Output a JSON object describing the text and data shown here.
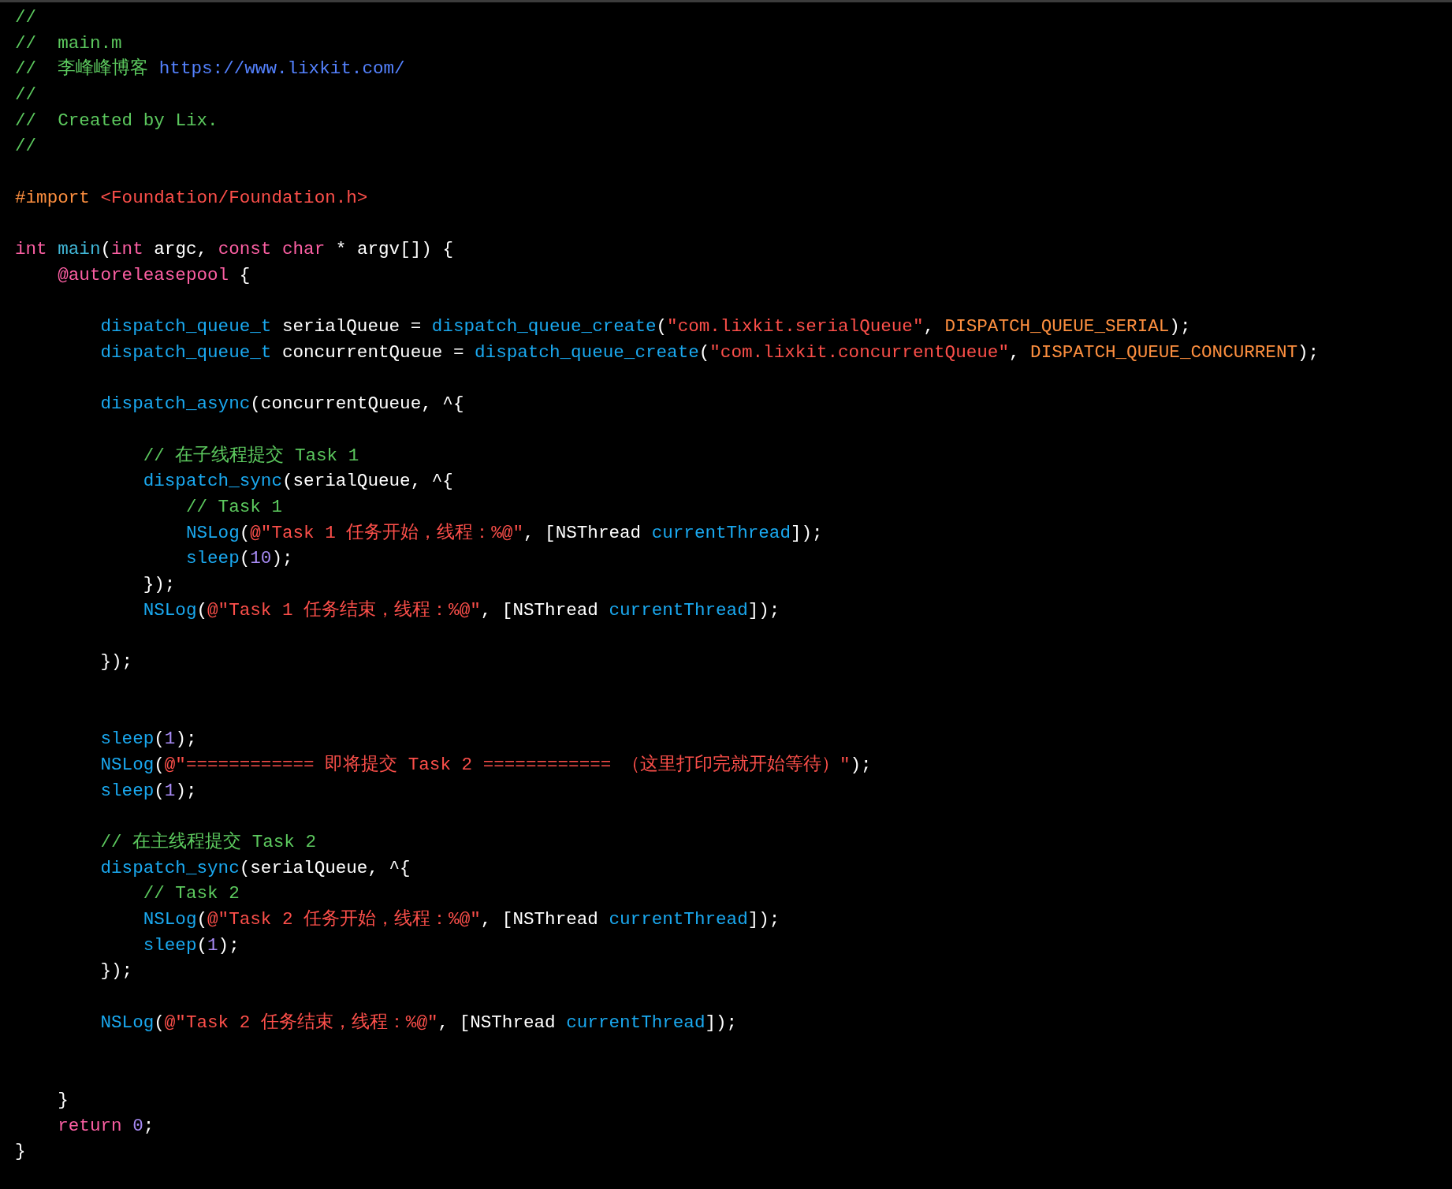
{
  "editor": {
    "lines": [
      {
        "kind": "code",
        "tokens": [
          {
            "kind": "comment",
            "text": "//"
          }
        ]
      },
      {
        "kind": "code",
        "tokens": [
          {
            "kind": "comment",
            "text": "//  main.m"
          }
        ]
      },
      {
        "kind": "code",
        "tokens": [
          {
            "kind": "comment",
            "text": "//  李峰峰博客 "
          },
          {
            "kind": "url",
            "text": "https://www.lixkit.com/"
          }
        ]
      },
      {
        "kind": "code",
        "tokens": [
          {
            "kind": "comment",
            "text": "//"
          }
        ]
      },
      {
        "kind": "code",
        "tokens": [
          {
            "kind": "comment",
            "text": "//  Created by Lix."
          }
        ]
      },
      {
        "kind": "code",
        "tokens": [
          {
            "kind": "comment",
            "text": "//"
          }
        ]
      },
      {
        "kind": "blank"
      },
      {
        "kind": "code",
        "tokens": [
          {
            "kind": "preproc",
            "text": "#import "
          },
          {
            "kind": "string",
            "text": "<Foundation/Foundation.h>"
          }
        ]
      },
      {
        "kind": "blank"
      },
      {
        "kind": "code",
        "tokens": [
          {
            "kind": "keyword",
            "text": "int "
          },
          {
            "kind": "decl",
            "text": "main"
          },
          {
            "kind": "plain",
            "text": "("
          },
          {
            "kind": "keyword",
            "text": "int"
          },
          {
            "kind": "plain",
            "text": " argc, "
          },
          {
            "kind": "keyword",
            "text": "const char"
          },
          {
            "kind": "plain",
            "text": " * argv[]) {"
          }
        ],
        "children": [
          {
            "kind": "code",
            "tokens": [
              {
                "kind": "keyword",
                "text": "@autoreleasepool"
              },
              {
                "kind": "plain",
                "text": " {"
              }
            ],
            "children": [
              {
                "kind": "blank"
              },
              {
                "kind": "code",
                "tokens": [
                  {
                    "kind": "func",
                    "text": "dispatch_queue_t"
                  },
                  {
                    "kind": "plain",
                    "text": " serialQueue = "
                  },
                  {
                    "kind": "func",
                    "text": "dispatch_queue_create"
                  },
                  {
                    "kind": "plain",
                    "text": "("
                  },
                  {
                    "kind": "string",
                    "text": "\"com.lixkit.serialQueue\""
                  },
                  {
                    "kind": "plain",
                    "text": ", "
                  },
                  {
                    "kind": "macro",
                    "text": "DISPATCH_QUEUE_SERIAL"
                  },
                  {
                    "kind": "plain",
                    "text": ");"
                  }
                ]
              },
              {
                "kind": "code",
                "tokens": [
                  {
                    "kind": "func",
                    "text": "dispatch_queue_t"
                  },
                  {
                    "kind": "plain",
                    "text": " concurrentQueue = "
                  },
                  {
                    "kind": "func",
                    "text": "dispatch_queue_create"
                  },
                  {
                    "kind": "plain",
                    "text": "("
                  },
                  {
                    "kind": "string",
                    "text": "\"com.lixkit.concurrentQueue\""
                  },
                  {
                    "kind": "plain",
                    "text": ", "
                  },
                  {
                    "kind": "macro",
                    "text": "DISPATCH_QUEUE_CONCURRENT"
                  },
                  {
                    "kind": "plain",
                    "text": ");"
                  }
                ]
              },
              {
                "kind": "blank"
              },
              {
                "kind": "code",
                "tokens": [
                  {
                    "kind": "func",
                    "text": "dispatch_async"
                  },
                  {
                    "kind": "plain",
                    "text": "(concurrentQueue, ^{"
                  }
                ],
                "children": [
                  {
                    "kind": "blank"
                  },
                  {
                    "kind": "code",
                    "tokens": [
                      {
                        "kind": "comment",
                        "text": "// 在子线程提交 Task 1"
                      }
                    ]
                  },
                  {
                    "kind": "code",
                    "tokens": [
                      {
                        "kind": "func",
                        "text": "dispatch_sync"
                      },
                      {
                        "kind": "plain",
                        "text": "(serialQueue, ^{"
                      }
                    ],
                    "children": [
                      {
                        "kind": "code",
                        "tokens": [
                          {
                            "kind": "comment",
                            "text": "// Task 1"
                          }
                        ]
                      },
                      {
                        "kind": "code",
                        "tokens": [
                          {
                            "kind": "func",
                            "text": "NSLog"
                          },
                          {
                            "kind": "plain",
                            "text": "("
                          },
                          {
                            "kind": "string",
                            "text": "@\"Task 1 任务开始，线程：%@\""
                          },
                          {
                            "kind": "plain",
                            "text": ", [NSThread "
                          },
                          {
                            "kind": "func",
                            "text": "currentThread"
                          },
                          {
                            "kind": "plain",
                            "text": "]);"
                          }
                        ]
                      },
                      {
                        "kind": "code",
                        "tokens": [
                          {
                            "kind": "func",
                            "text": "sleep"
                          },
                          {
                            "kind": "plain",
                            "text": "("
                          },
                          {
                            "kind": "number",
                            "text": "10"
                          },
                          {
                            "kind": "plain",
                            "text": ");"
                          }
                        ]
                      }
                    ]
                  },
                  {
                    "kind": "code",
                    "tokens": [
                      {
                        "kind": "plain",
                        "text": "});"
                      }
                    ]
                  },
                  {
                    "kind": "code",
                    "tokens": [
                      {
                        "kind": "func",
                        "text": "NSLog"
                      },
                      {
                        "kind": "plain",
                        "text": "("
                      },
                      {
                        "kind": "string",
                        "text": "@\"Task 1 任务结束，线程：%@\""
                      },
                      {
                        "kind": "plain",
                        "text": ", [NSThread "
                      },
                      {
                        "kind": "func",
                        "text": "currentThread"
                      },
                      {
                        "kind": "plain",
                        "text": "]);"
                      }
                    ]
                  },
                  {
                    "kind": "blank"
                  }
                ]
              },
              {
                "kind": "code",
                "tokens": [
                  {
                    "kind": "plain",
                    "text": "});"
                  }
                ]
              },
              {
                "kind": "blank"
              },
              {
                "kind": "blank"
              },
              {
                "kind": "code",
                "tokens": [
                  {
                    "kind": "func",
                    "text": "sleep"
                  },
                  {
                    "kind": "plain",
                    "text": "("
                  },
                  {
                    "kind": "number",
                    "text": "1"
                  },
                  {
                    "kind": "plain",
                    "text": ");"
                  }
                ]
              },
              {
                "kind": "code",
                "tokens": [
                  {
                    "kind": "func",
                    "text": "NSLog"
                  },
                  {
                    "kind": "plain",
                    "text": "("
                  },
                  {
                    "kind": "string",
                    "text": "@\"============ 即将提交 Task 2 ============ （这里打印完就开始等待）\""
                  },
                  {
                    "kind": "plain",
                    "text": ");"
                  }
                ]
              },
              {
                "kind": "code",
                "tokens": [
                  {
                    "kind": "func",
                    "text": "sleep"
                  },
                  {
                    "kind": "plain",
                    "text": "("
                  },
                  {
                    "kind": "number",
                    "text": "1"
                  },
                  {
                    "kind": "plain",
                    "text": ");"
                  }
                ]
              },
              {
                "kind": "blank"
              },
              {
                "kind": "code",
                "tokens": [
                  {
                    "kind": "comment",
                    "text": "// 在主线程提交 Task 2"
                  }
                ]
              },
              {
                "kind": "code",
                "tokens": [
                  {
                    "kind": "func",
                    "text": "dispatch_sync"
                  },
                  {
                    "kind": "plain",
                    "text": "(serialQueue, ^{"
                  }
                ],
                "children": [
                  {
                    "kind": "code",
                    "tokens": [
                      {
                        "kind": "comment",
                        "text": "// Task 2"
                      }
                    ]
                  },
                  {
                    "kind": "code",
                    "tokens": [
                      {
                        "kind": "func",
                        "text": "NSLog"
                      },
                      {
                        "kind": "plain",
                        "text": "("
                      },
                      {
                        "kind": "string",
                        "text": "@\"Task 2 任务开始，线程：%@\""
                      },
                      {
                        "kind": "plain",
                        "text": ", [NSThread "
                      },
                      {
                        "kind": "func",
                        "text": "currentThread"
                      },
                      {
                        "kind": "plain",
                        "text": "]);"
                      }
                    ]
                  },
                  {
                    "kind": "code",
                    "tokens": [
                      {
                        "kind": "func",
                        "text": "sleep"
                      },
                      {
                        "kind": "plain",
                        "text": "("
                      },
                      {
                        "kind": "number",
                        "text": "1"
                      },
                      {
                        "kind": "plain",
                        "text": ");"
                      }
                    ]
                  }
                ]
              },
              {
                "kind": "code",
                "tokens": [
                  {
                    "kind": "plain",
                    "text": "});"
                  }
                ]
              },
              {
                "kind": "blank"
              },
              {
                "kind": "code",
                "tokens": [
                  {
                    "kind": "func",
                    "text": "NSLog"
                  },
                  {
                    "kind": "plain",
                    "text": "("
                  },
                  {
                    "kind": "string",
                    "text": "@\"Task 2 任务结束，线程：%@\""
                  },
                  {
                    "kind": "plain",
                    "text": ", [NSThread "
                  },
                  {
                    "kind": "func",
                    "text": "currentThread"
                  },
                  {
                    "kind": "plain",
                    "text": "]);"
                  }
                ]
              },
              {
                "kind": "blank"
              },
              {
                "kind": "blank"
              }
            ]
          },
          {
            "kind": "code",
            "tokens": [
              {
                "kind": "plain",
                "text": "}"
              }
            ]
          },
          {
            "kind": "code",
            "tokens": [
              {
                "kind": "keyword",
                "text": "return "
              },
              {
                "kind": "number",
                "text": "0"
              },
              {
                "kind": "plain",
                "text": ";"
              }
            ]
          }
        ]
      },
      {
        "kind": "code",
        "tokens": [
          {
            "kind": "plain",
            "text": "}"
          }
        ]
      }
    ]
  }
}
